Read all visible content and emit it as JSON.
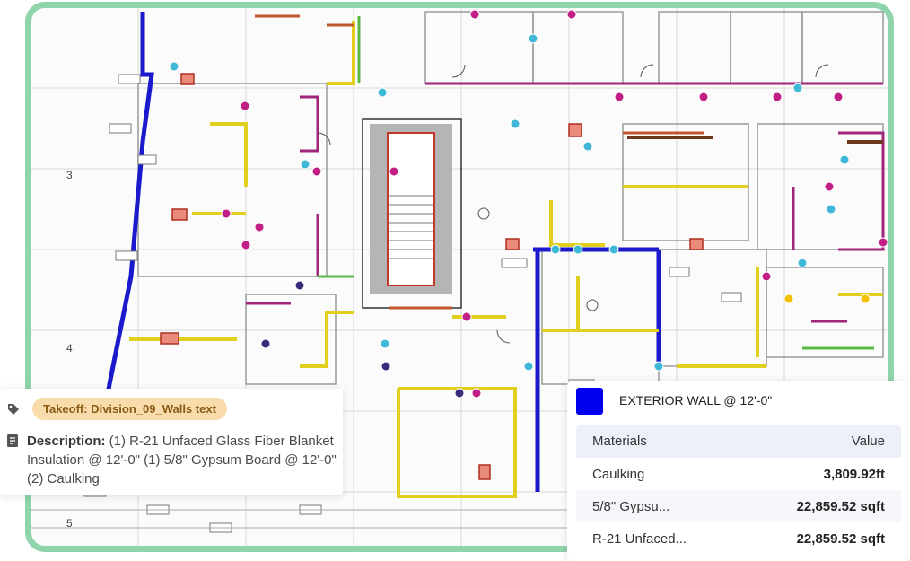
{
  "plan": {
    "grid_numbers": [
      "3",
      "4",
      "5"
    ]
  },
  "takeoff": {
    "tag_label": "Takeoff: Division_09_Walls text",
    "tag_color": "#f8dcab",
    "description_label": "Description:",
    "description_text": " (1) R-21 Unfaced Glass Fiber Blanket Insulation @ 12'-0\" (1) 5/8\" Gypsum Board @ 12'-0\" (2) Caulking"
  },
  "wall_panel": {
    "swatch_color": "#0000ee",
    "title": "EXTERIOR WALL @ 12'-0\"",
    "columns": [
      "Materials",
      "Value"
    ],
    "rows": [
      {
        "material": "Caulking",
        "value": "3,809.92ft"
      },
      {
        "material": "5/8\" Gypsu...",
        "value": "22,859.52 sqft"
      },
      {
        "material": "R-21 Unfaced...",
        "value": "22,859.52 sqft"
      }
    ]
  }
}
